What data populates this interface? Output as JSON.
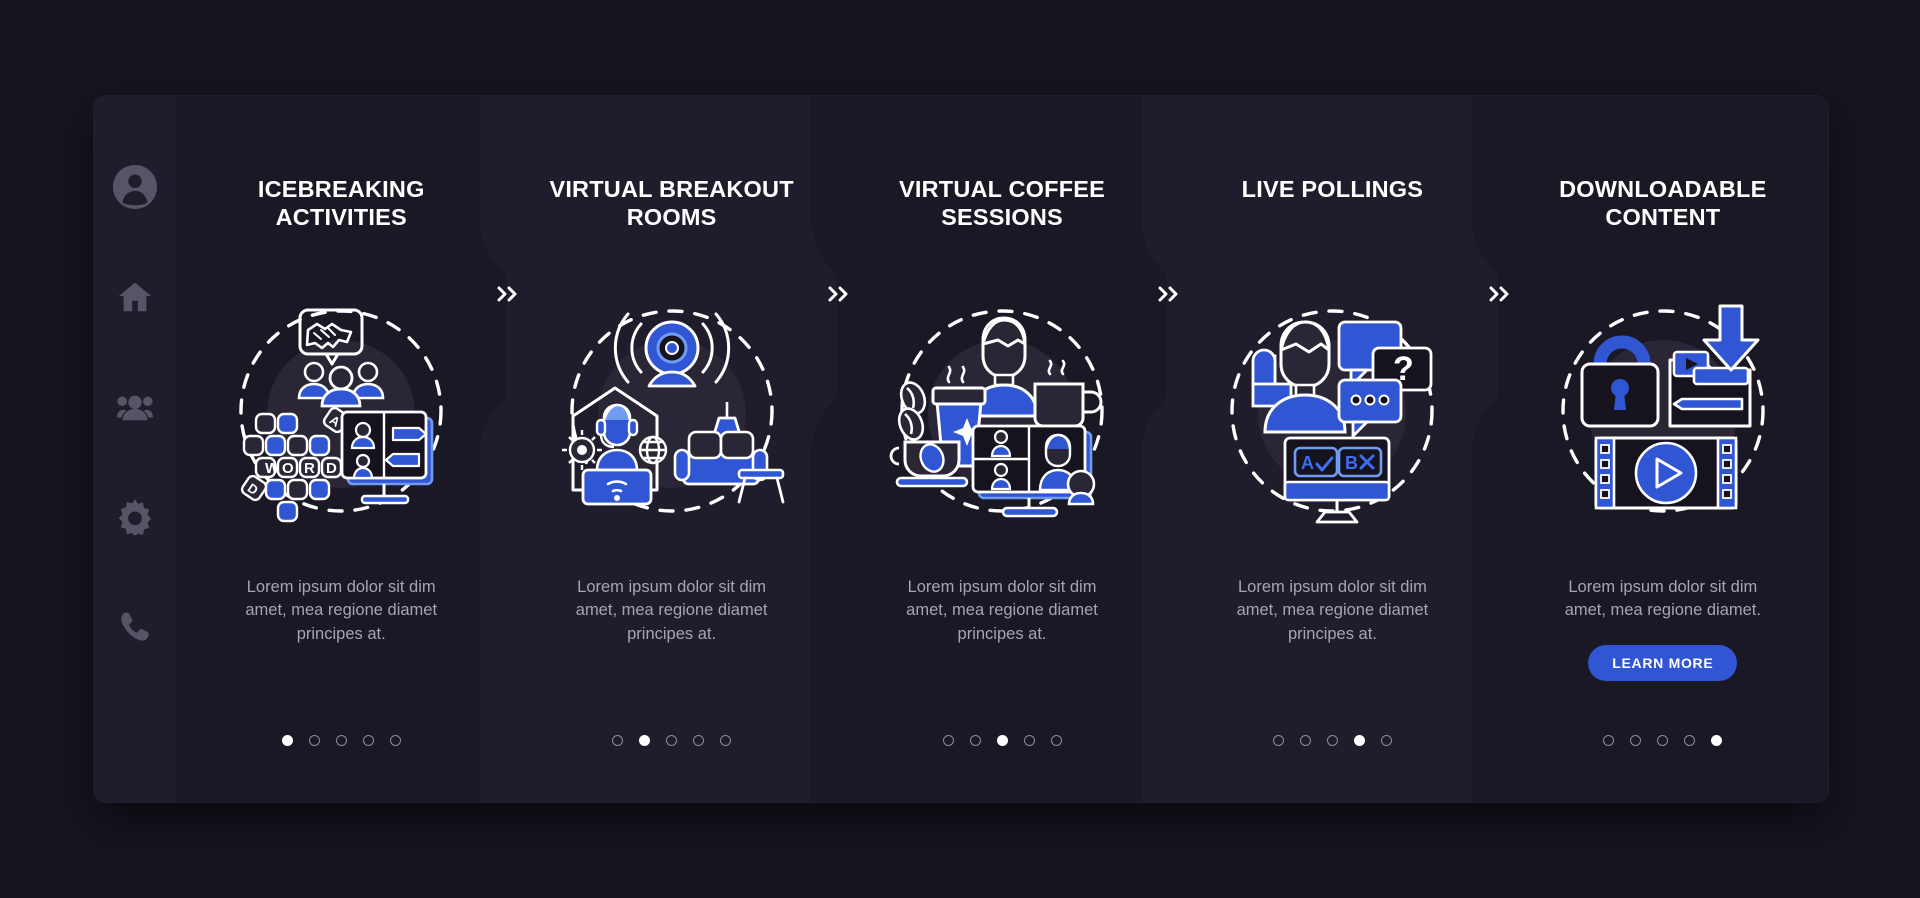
{
  "theme": {
    "page_bg": "#17141f",
    "card_bg": "#1b1825",
    "panel_alt_bg": "#201c2b",
    "sidebar_bg": "#201c2b",
    "accent_blue": "#3056d3",
    "title_color": "#ffffff",
    "body_color": "#a7a4b2",
    "sidebar_icon_color": "#585468"
  },
  "sidebar": {
    "items": [
      {
        "icon": "user-avatar-icon",
        "label": "Profile"
      },
      {
        "icon": "home-icon",
        "label": "Home"
      },
      {
        "icon": "people-group-icon",
        "label": "Community"
      },
      {
        "icon": "gear-icon",
        "label": "Settings"
      },
      {
        "icon": "phone-icon",
        "label": "Contact"
      }
    ]
  },
  "separator": {
    "glyph": "»",
    "name": "double-chevron-right-icon"
  },
  "panels": [
    {
      "title": "ICEBREAKING ACTIVITIES",
      "illustration": "icebreaking-activities-illustration",
      "description": "Lorem ipsum dolor sit dim amet, mea regione diamet principes at.",
      "dots": {
        "count": 5,
        "active": 1
      },
      "button": null
    },
    {
      "title": "VIRTUAL BREAKOUT ROOMS",
      "illustration": "virtual-breakout-rooms-illustration",
      "description": "Lorem ipsum dolor sit dim amet, mea regione diamet principes at.",
      "dots": {
        "count": 5,
        "active": 2
      },
      "button": null
    },
    {
      "title": "VIRTUAL COFFEE SESSIONS",
      "illustration": "virtual-coffee-sessions-illustration",
      "description": "Lorem ipsum dolor sit dim amet, mea regione diamet principes at.",
      "dots": {
        "count": 5,
        "active": 3
      },
      "button": null
    },
    {
      "title": "LIVE POLLINGS",
      "illustration": "live-pollings-illustration",
      "description": "Lorem ipsum dolor sit dim amet, mea regione diamet principes at.",
      "dots": {
        "count": 5,
        "active": 4
      },
      "button": null
    },
    {
      "title": "DOWNLOADABLE CONTENT",
      "illustration": "downloadable-content-illustration",
      "description": "Lorem ipsum dolor sit dim amet, mea regione diamet.",
      "dots": {
        "count": 5,
        "active": 5
      },
      "button": "LEARN MORE"
    }
  ]
}
